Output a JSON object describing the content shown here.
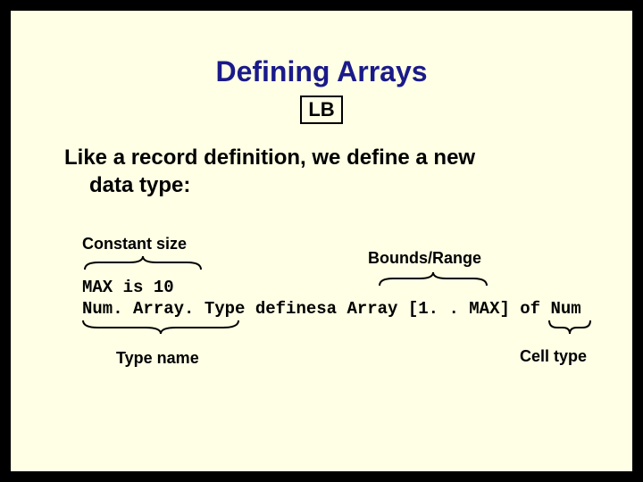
{
  "title": "Defining Arrays",
  "lb_label": "LB",
  "body_line1": "Like a record definition, we define a new",
  "body_line2": "data type:",
  "labels": {
    "constant_size": "Constant size",
    "bounds_range": "Bounds/Range",
    "type_name": "Type name",
    "cell_type": "Cell type"
  },
  "code": {
    "line1": "MAX is 10",
    "line2": "Num. Array. Type definesa Array [1. . MAX] of Num"
  }
}
